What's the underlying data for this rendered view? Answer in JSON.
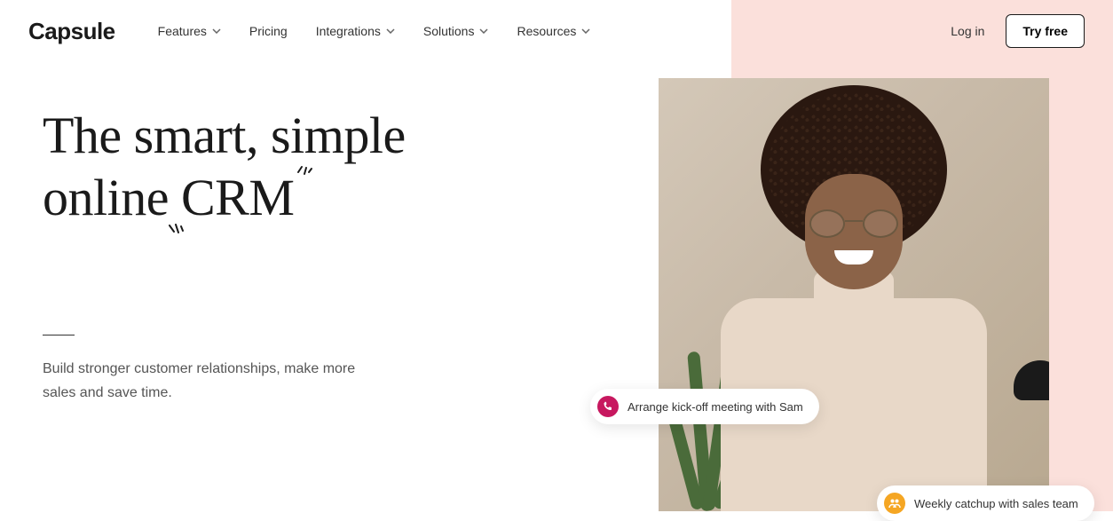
{
  "brand": "Capsule",
  "nav": {
    "items": [
      {
        "label": "Features",
        "has_dropdown": true
      },
      {
        "label": "Pricing",
        "has_dropdown": false
      },
      {
        "label": "Integrations",
        "has_dropdown": true
      },
      {
        "label": "Solutions",
        "has_dropdown": true
      },
      {
        "label": "Resources",
        "has_dropdown": true
      }
    ]
  },
  "auth": {
    "login": "Log in",
    "cta": "Try free"
  },
  "hero": {
    "title_line1": "The smart, simple",
    "title_line2_prefix": "online ",
    "title_line2_em": "CRM",
    "subtext": "Build stronger customer relationships, make more sales and save time."
  },
  "chips": [
    {
      "icon": "phone-icon",
      "text": "Arrange kick-off meeting with Sam",
      "color": "#c7185f"
    },
    {
      "icon": "people-icon",
      "text": "Weekly catchup with sales team",
      "color": "#f5a623"
    }
  ]
}
